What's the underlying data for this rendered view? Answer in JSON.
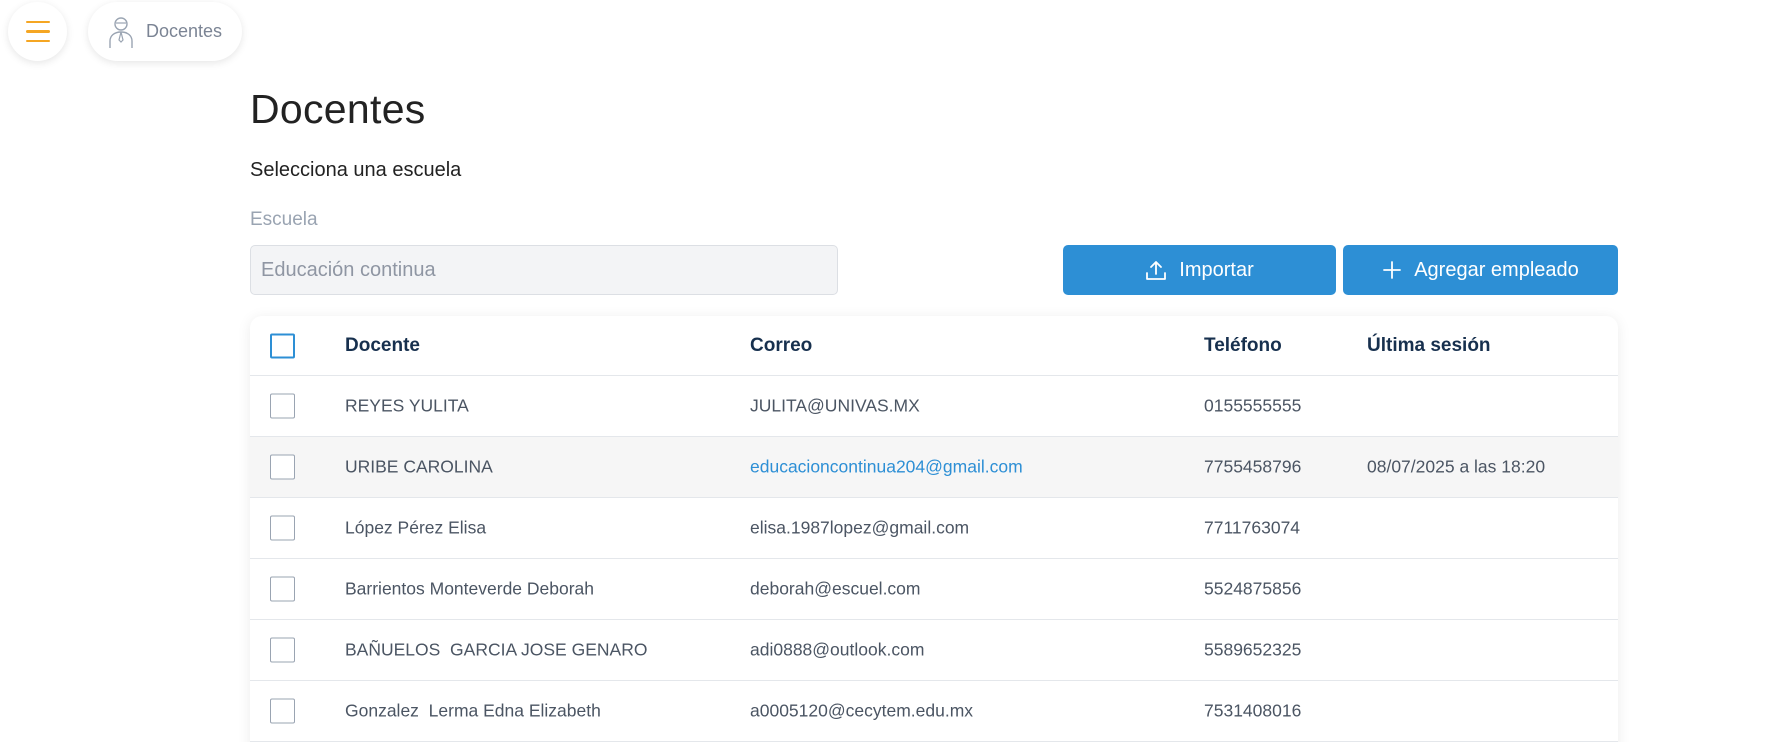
{
  "nav": {
    "menu_icon": "hamburger-icon",
    "breadcrumb_icon": "teacher-icon",
    "breadcrumb_label": "Docentes"
  },
  "page": {
    "title": "Docentes",
    "subtitle": "Selecciona una escuela"
  },
  "school_select": {
    "label": "Escuela",
    "value": "Educación continua"
  },
  "actions": {
    "import_label": "Importar",
    "import_icon": "upload-icon",
    "add_label": "Agregar empleado",
    "add_icon": "plus-icon"
  },
  "table": {
    "columns": [
      "Docente",
      "Correo",
      "Teléfono",
      "Última sesión"
    ],
    "rows": [
      {
        "name": "REYES YULITA",
        "email": "JULITA@UNIVAS.MX",
        "phone": "0155555555",
        "last": ""
      },
      {
        "name": "URIBE CAROLINA",
        "email": "educacioncontinua204@gmail.com",
        "phone": "7755458796",
        "last": "08/07/2025 a las 18:20"
      },
      {
        "name": "López Pérez Elisa",
        "email": "elisa.1987lopez@gmail.com",
        "phone": "7711763074",
        "last": ""
      },
      {
        "name": "Barrientos Monteverde Deborah",
        "email": "deborah@escuel.com",
        "phone": "5524875856",
        "last": ""
      },
      {
        "name": "BAÑUELOS  GARCIA JOSE GENARO",
        "email": "adi0888@outlook.com",
        "phone": "5589652325",
        "last": ""
      },
      {
        "name": "Gonzalez  Lerma Edna Elizabeth",
        "email": "a0005120@cecytem.edu.mx",
        "phone": "7531408016",
        "last": ""
      }
    ]
  },
  "colors": {
    "primary": "#2d8fd5",
    "accent": "#f5a623",
    "heading": "#17304e"
  }
}
